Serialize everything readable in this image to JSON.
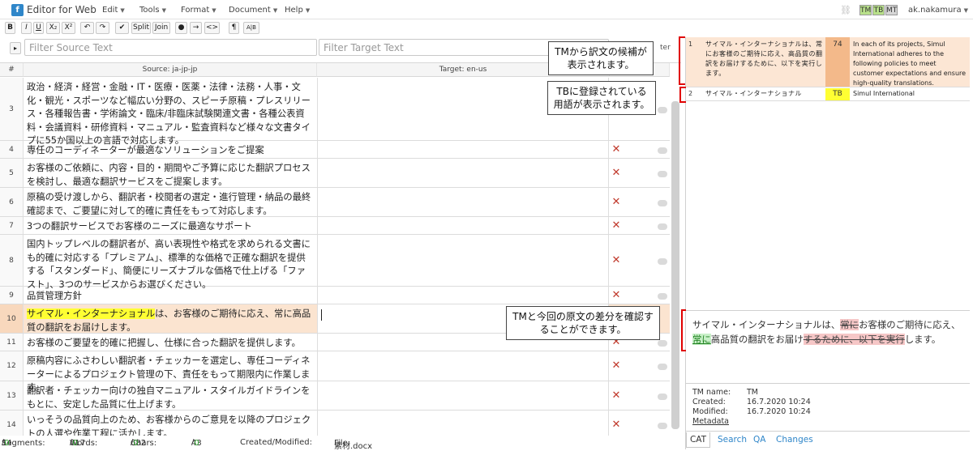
{
  "app": {
    "title": "Editor for Web",
    "logo_letter": "f"
  },
  "menu": [
    "Edit",
    "Tools",
    "Format",
    "Document",
    "Help"
  ],
  "user": {
    "name": "ak.nakamura",
    "badges": [
      "TM",
      "TB",
      "MT"
    ]
  },
  "toolbar": [
    "B",
    "I",
    "U",
    "X₂",
    "X²",
    "↶",
    "↷",
    "✔",
    "Split",
    "Join",
    "●",
    "→",
    "<>",
    "¶",
    "A|B"
  ],
  "filters": {
    "source_placeholder": "Filter Source Text",
    "target_placeholder": "Filter Target Text",
    "extra": "ter"
  },
  "grid": {
    "head_num": "#",
    "head_source": "Source: ja-jp-jp",
    "head_target": "Target: en-us",
    "rows": [
      {
        "n": "3",
        "src": "政治・経済・経営・金融・IT・医療・医薬・法律・法務・人事・文化・観光・スポーツなど幅広い分野の、スピーチ原稿・プレスリリース・各種報告書・学術論文・臨床/非臨床試験関連文書・各種公表資料・会議資料・研修資料・マニュアル・監査資料など様々な文書タイプに55か国以上の言語で対応します。"
      },
      {
        "n": "4",
        "src": "専任のコーディネーターが最適なソリューションをご提案"
      },
      {
        "n": "5",
        "src": "お客様のご依頼に、内容・目的・期間やご予算に応じた翻訳プロセスを検討し、最適な翻訳サービスをご提案します。"
      },
      {
        "n": "6",
        "src": "原稿の受け渡しから、翻訳者・校閲者の選定・進行管理・納品の最終確認まで、ご要望に対して的確に責任をもって対応します。"
      },
      {
        "n": "7",
        "src": "3つの翻訳サービスでお客様のニーズに最適なサポート"
      },
      {
        "n": "8",
        "src": "国内トップレベルの翻訳者が、高い表現性や格式を求められる文書にも的確に対応する「プレミアム」、標準的な価格で正確な翻訳を提供する「スタンダード」、簡便にリーズナブルな価格で仕上げる「ファスト」、3つのサービスからお選びください。"
      },
      {
        "n": "9",
        "src": "品質管理方針"
      },
      {
        "n": "10",
        "src_hl": "サイマル・インターナショナル",
        "src_rest": "は、お客様のご期待に応え、常に高品質の翻訳をお届けします。"
      },
      {
        "n": "11",
        "src": "お客様のご要望を的確に把握し、仕様に合った翻訳を提供します。"
      },
      {
        "n": "12",
        "src": "原稿内容にふさわしい翻訳者・チェッカーを選定し、専任コーディネーターによるプロジェクト管理の下、責任をもって期限内に作業します。"
      },
      {
        "n": "13",
        "src": "翻訳者・チェッカー向けの独自マニュアル・スタイルガイドラインをもとに、安定した品質に仕上げます。"
      },
      {
        "n": "14",
        "src": "いっそうの品質向上のため、お客様からのご意見を以降のプロジェクトの人選や作業工程に活かします。"
      }
    ]
  },
  "statusbar": {
    "segments_label": "Segments:",
    "segments_a": "14",
    "segments_b": "0",
    "words_label": "Words:",
    "words_a": "617",
    "words_b": "0",
    "chars_label": "Chars:",
    "chars_a": "682",
    "chars_b": "0",
    "count_a": "43",
    "count_b": "0",
    "created_label": "Created/Modified:",
    "file_label": "File:",
    "file_name": "素材.docx"
  },
  "matches": [
    {
      "n": "1",
      "src": "サイマル・インターナショナルは、常にお客様のご期待に応え、高品質の翻訳をお届けするために、以下を実行します。",
      "score": "74",
      "tgt": "In each of its projects, Simul International adheres to the following policies to meet customer expectations and ensure high-quality translations."
    },
    {
      "n": "2",
      "src": "サイマル・インターナショナル",
      "score": "TB",
      "tgt": "Simul International"
    }
  ],
  "diff": {
    "p1": "サイマル・インターナショナルは、",
    "d1": "常に",
    "p2": "お客様のご期待に応え、",
    "i1": "常に",
    "p3": "高品質の翻訳をお届け",
    "d2": "するために、以下を実行",
    "p4": "します。"
  },
  "meta": {
    "tm_name_label": "TM name:",
    "tm_name": "TM",
    "created_label": "Created:",
    "created": "16.7.2020 10:24",
    "modified_label": "Modified:",
    "modified": "16.7.2020 10:24",
    "metadata_link": "Metadata"
  },
  "tabs": [
    "CAT",
    "Search",
    "QA",
    "Changes"
  ],
  "callouts": {
    "tm": "TMから訳文の候補が表示されます。",
    "tb": "TBに登録されている用語が表示されます。",
    "diff": "TMと今回の原文の差分を確認することができます。"
  },
  "colors": {
    "accent": "#2f86c9",
    "active_row": "#fbe4d0",
    "score": "#f3b98a",
    "tb": "#ffff33",
    "callout_border": "#e00000"
  }
}
